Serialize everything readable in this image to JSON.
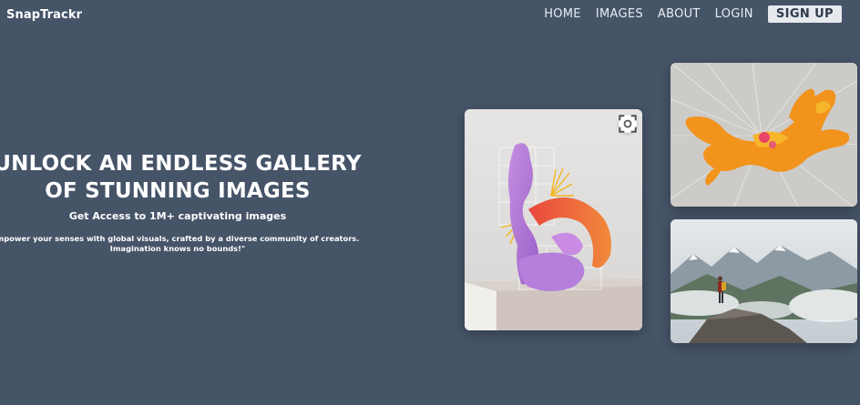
{
  "brand": {
    "name": "SnapTrackr"
  },
  "nav": {
    "items": [
      {
        "label": "HOME"
      },
      {
        "label": "IMAGES"
      },
      {
        "label": "ABOUT"
      },
      {
        "label": "LOGIN"
      }
    ],
    "signup_label": "SIGN UP"
  },
  "hero": {
    "title_line1": "UNLOCK AN ENDLESS GALLERY",
    "title_line2": "OF STUNNING IMAGES",
    "subtitle": "Get Access to 1M+ captivating images",
    "description_line1": "mpower your senses with global visuals, crafted by a diverse community of creators.",
    "description_line2": "Imagination knows no bounds!\""
  },
  "gallery": {
    "images": [
      {
        "subject": "purple-orange-3d-sculpture",
        "icon": "lens-icon"
      },
      {
        "subject": "orange-coral-sculpture"
      },
      {
        "subject": "hiker-on-mountain-cliff"
      }
    ]
  }
}
